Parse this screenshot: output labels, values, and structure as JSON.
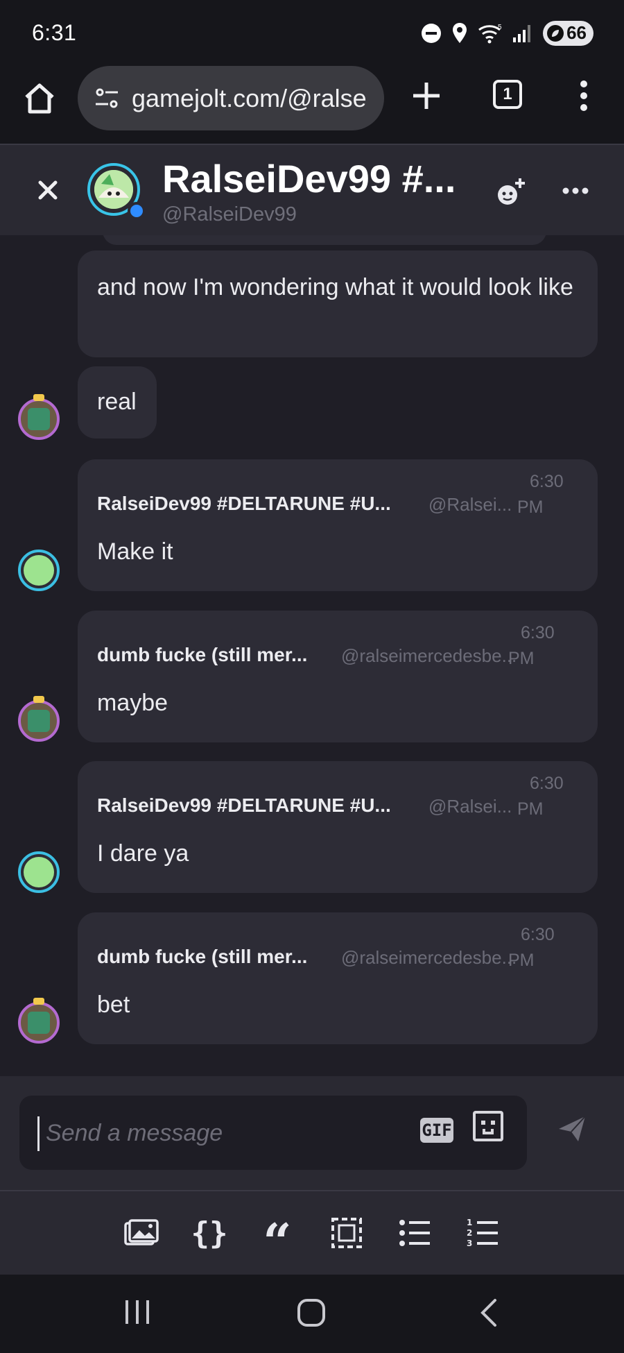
{
  "status_bar": {
    "time": "6:31",
    "battery": "66",
    "wifi_badge": "5"
  },
  "browser": {
    "url": "gamejolt.com/@ralse",
    "tab_count": "1"
  },
  "chat_header": {
    "title": "RalseiDev99 #...",
    "handle": "@RalseiDev99",
    "online_color": "#2f8cff"
  },
  "messages": [
    {
      "type": "continuation",
      "text": "and now I'm wondering what it would look like"
    },
    {
      "type": "continuation",
      "text": "real",
      "avatar": "dumb"
    },
    {
      "type": "full",
      "author": "RalseiDev99 #DELTARUNE #U...",
      "handle": "@Ralsei...",
      "time_line1": "6:30",
      "time_line2": "PM",
      "text": "Make it",
      "avatar": "ralsei"
    },
    {
      "type": "full",
      "author": "dumb fucke (still mer...",
      "handle": "@ralseimercedesbe...",
      "time_line1": "6:30",
      "time_line2": "PM",
      "text": "maybe",
      "avatar": "dumb"
    },
    {
      "type": "full",
      "author": "RalseiDev99 #DELTARUNE #U...",
      "handle": "@Ralsei...",
      "time_line1": "6:30",
      "time_line2": "PM",
      "text": "I dare ya",
      "avatar": "ralsei"
    },
    {
      "type": "full",
      "author": "dumb fucke (still mer...",
      "handle": "@ralseimercedesbe...",
      "time_line1": "6:30",
      "time_line2": "PM",
      "text": "bet",
      "avatar": "dumb"
    }
  ],
  "composer": {
    "placeholder": "Send a message",
    "value": "",
    "gif_label": "GIF"
  },
  "format_toolbar": {
    "items": [
      "image-icon",
      "code-icon",
      "quote-icon",
      "spoiler-icon",
      "bullet-list-icon",
      "numbered-list-icon"
    ],
    "code_label": "{}",
    "quote_label": "“"
  },
  "colors": {
    "background": "#1f1e26",
    "bubble": "#2d2c36",
    "header": "#2a2932",
    "muted_text": "#6c6c78",
    "accent_ring": "#3bbfe3"
  }
}
